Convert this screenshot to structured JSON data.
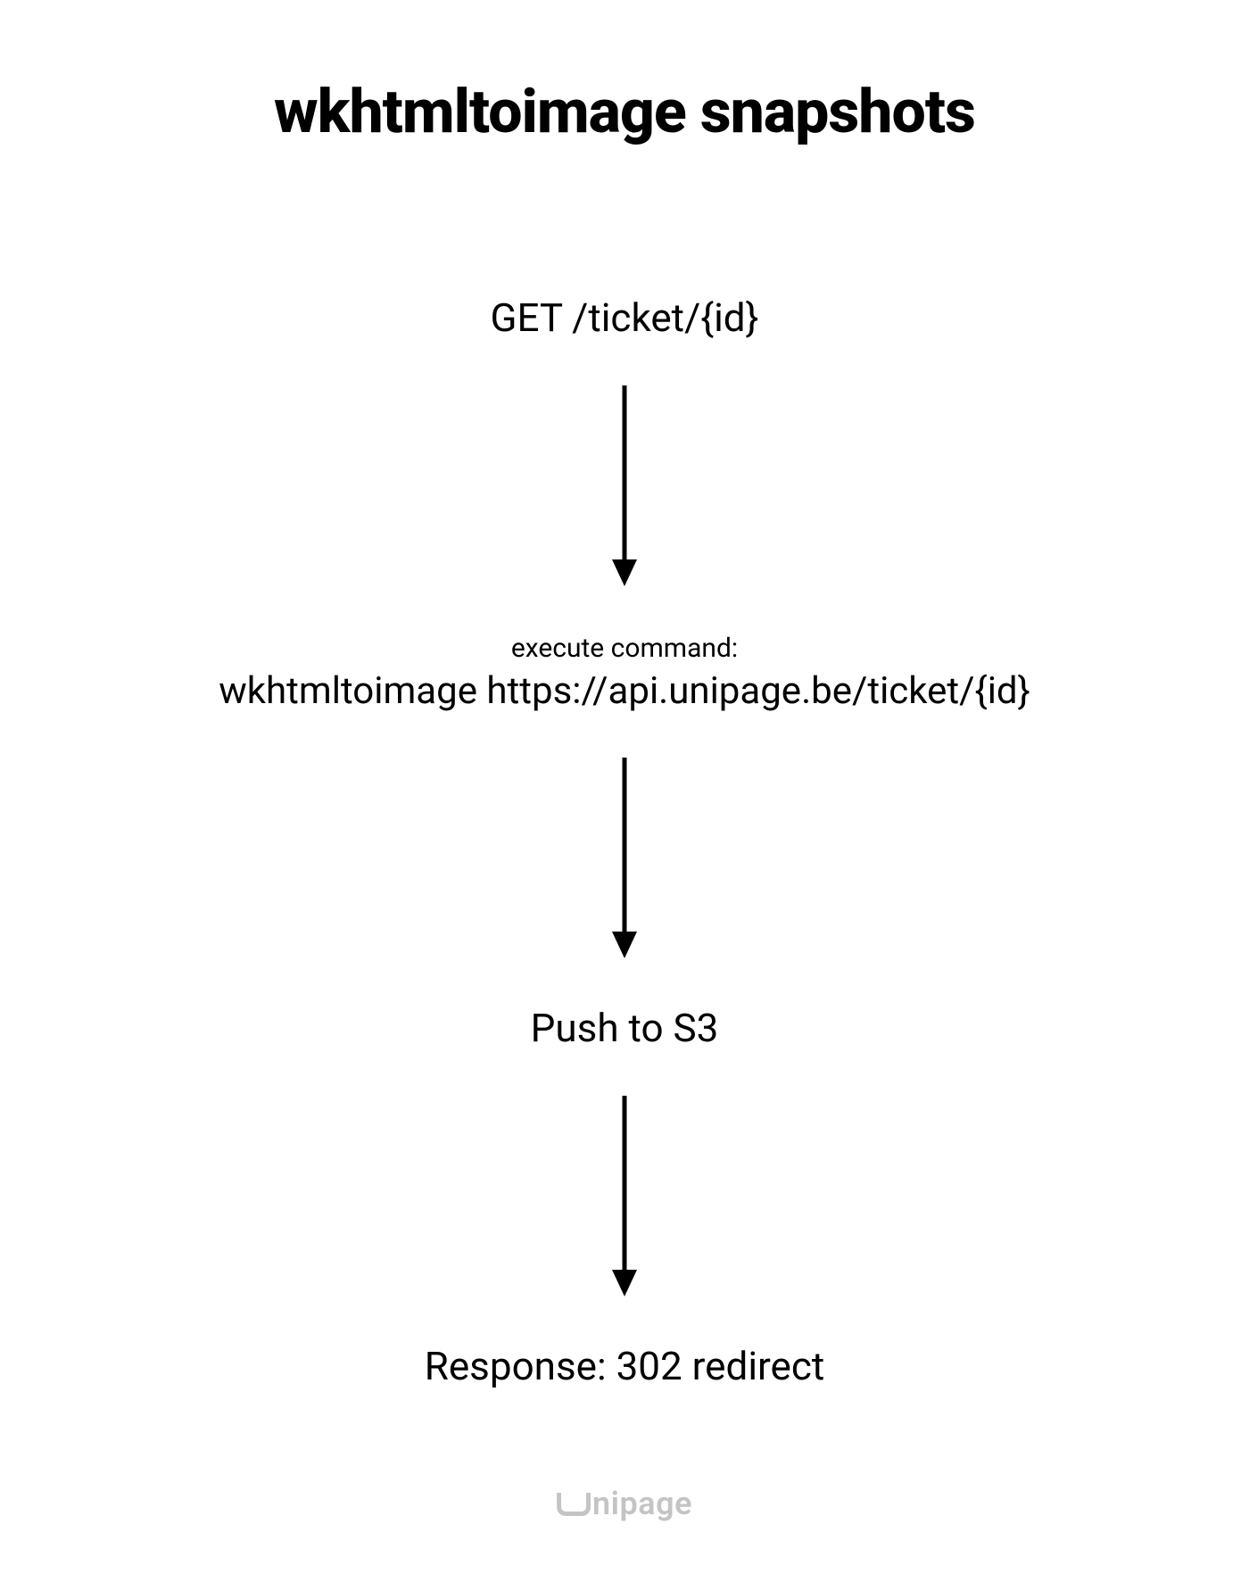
{
  "title": "wkhtmltoimage snapshots",
  "steps": {
    "step1": "GET /ticket/{id}",
    "step2_label": "execute command:",
    "step2_command": "wkhtmltoimage https://api.unipage.be/ticket/{id}",
    "step3": "Push to S3",
    "step4": "Response: 302 redirect"
  },
  "footer": {
    "brand": "nipage"
  }
}
